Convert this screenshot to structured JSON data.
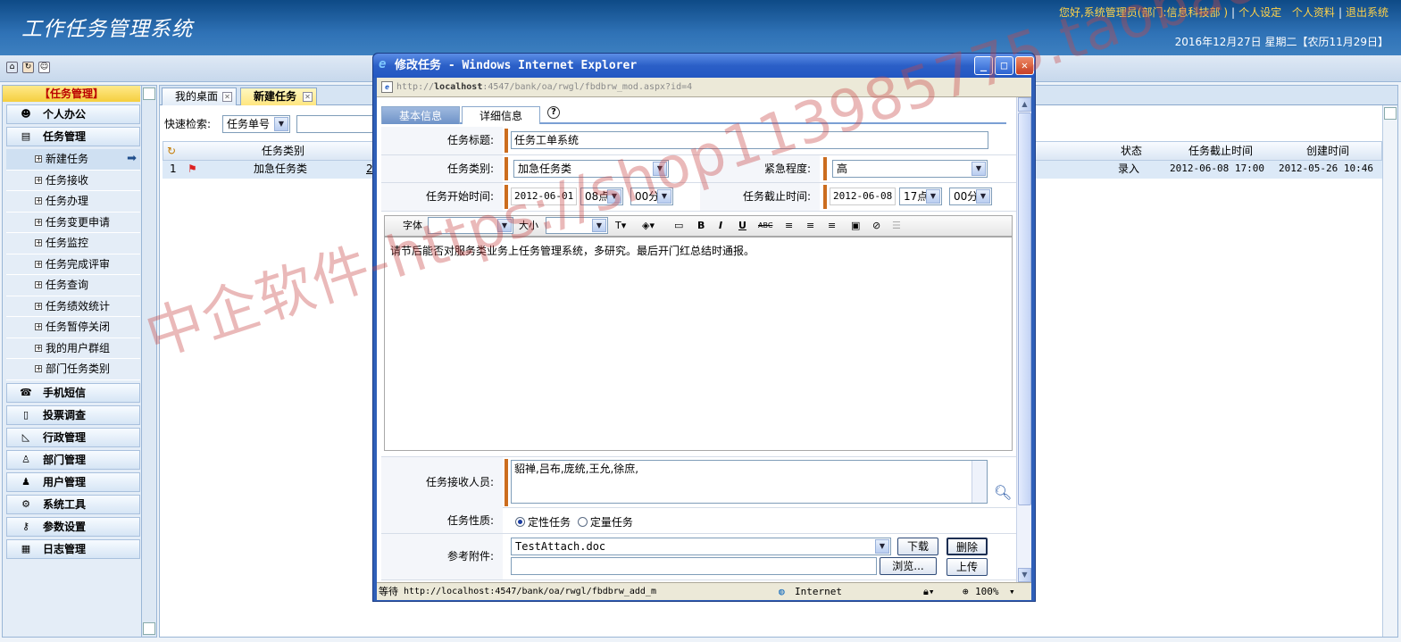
{
  "app": {
    "title": "工作任务管理系统",
    "greeting": "您好,系统管理员(部门:信息科技部 )",
    "links": [
      "个人设定",
      "个人资料",
      "退出系统"
    ],
    "date": "2016年12月27日 星期二【农历11月29日】"
  },
  "sidebar": {
    "header": "【任务管理】",
    "groups_top": [
      {
        "label": "个人办公",
        "icon": "person-icon"
      },
      {
        "label": "任务管理",
        "icon": "task-icon"
      }
    ],
    "items": [
      "新建任务",
      "任务接收",
      "任务办理",
      "任务变更申请",
      "任务监控",
      "任务完成评审",
      "任务查询",
      "任务绩效统计",
      "任务暂停关闭",
      "我的用户群组",
      "部门任务类别"
    ],
    "groups_bottom": [
      {
        "label": "手机短信",
        "icon": "phone-icon"
      },
      {
        "label": "投票调查",
        "icon": "vote-icon"
      },
      {
        "label": "行政管理",
        "icon": "ruler-icon"
      },
      {
        "label": "部门管理",
        "icon": "dept-icon"
      },
      {
        "label": "用户管理",
        "icon": "user-icon"
      },
      {
        "label": "系统工具",
        "icon": "gear-icon"
      },
      {
        "label": "参数设置",
        "icon": "key-icon"
      },
      {
        "label": "日志管理",
        "icon": "calendar-icon"
      }
    ]
  },
  "main": {
    "tabs": [
      "我的桌面",
      "新建任务"
    ],
    "quick_search_label": "快速检索:",
    "search_field": "任务单号",
    "columns": {
      "category": "任务类别",
      "status": "状态",
      "deadline": "任务截止时间",
      "created": "创建时间"
    },
    "row": {
      "num": "1",
      "category": "加急任务类",
      "num2": "2",
      "status": "录入",
      "deadline": "2012-06-08 17:00",
      "created": "2012-05-26 10:46"
    }
  },
  "dialog": {
    "title": "修改任务 - Windows Internet Explorer",
    "address_prefix": "http://",
    "address_host": "localhost",
    "address_rest": ":4547/bank/oa/rwgl/fbdbrw_mod.aspx?id=4",
    "tabs": [
      "基本信息",
      "详细信息"
    ],
    "help": "?",
    "fields": {
      "title_label": "任务标题:",
      "title_value": "任务工单系统",
      "category_label": "任务类别:",
      "category_value": "加急任务类",
      "urgency_label": "紧急程度:",
      "urgency_value": "高",
      "start_label": "任务开始时间:",
      "start_date": "2012-06-01",
      "start_hour": "08点",
      "start_min": "00分",
      "end_label": "任务截止时间:",
      "end_date": "2012-06-08",
      "end_hour": "17点",
      "end_min": "00分",
      "editor_font_label": "字体",
      "editor_size_label": "大小",
      "content": "请节后能否对服务类业务上任务管理系统，多研究。最后开门红总结时通报。",
      "receivers_label": "任务接收人员:",
      "receivers_value": "貂禅,吕布,庞统,王允,徐庶,",
      "nature_label": "任务性质:",
      "nature_opt1": "定性任务",
      "nature_opt2": "定量任务",
      "attach_label": "参考附件:",
      "attach_value": "TestAttach.doc",
      "download": "下载",
      "delete": "删除",
      "browse": "浏览...",
      "upload": "上传"
    },
    "status": {
      "wait": "等待",
      "url": "http://localhost:4547/bank/oa/rwgl/fbdbrw_add_m",
      "zone": "Internet",
      "zoom": "100%"
    }
  },
  "watermark": "中企软件-https://shop113985775.taobao.com",
  "colors": {
    "header_bg": "#2f72b6",
    "accent_bar": "#cc6d1e",
    "title_bar": "#2b5fc7"
  }
}
